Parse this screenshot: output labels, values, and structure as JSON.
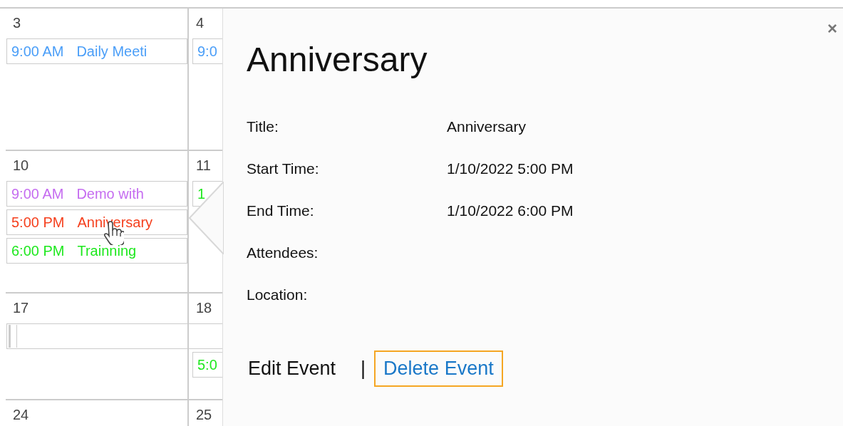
{
  "calendar": {
    "weeks": [
      {
        "days": [
          {
            "number": "3",
            "events": [
              {
                "kind": "event",
                "time": "9:00 AM",
                "title": "Daily Meeti",
                "color": "#4a9ef8"
              }
            ]
          },
          {
            "number": "4",
            "events": [
              {
                "kind": "event",
                "time": "9:0",
                "color": "#4a9ef8"
              }
            ]
          }
        ]
      },
      {
        "days": [
          {
            "number": "10",
            "events": [
              {
                "kind": "event",
                "time": "9:00 AM",
                "title": "Demo with",
                "color": "#c56cf0"
              },
              {
                "kind": "event",
                "time": "5:00 PM",
                "title": "Anniversary",
                "color": "#f5401e"
              },
              {
                "kind": "event",
                "time": "6:00 PM",
                "title": "Trainning",
                "color": "#1ee81e"
              }
            ]
          },
          {
            "number": "11",
            "events": [
              {
                "kind": "event",
                "time": "1",
                "color": "#1ee81e"
              }
            ]
          }
        ]
      },
      {
        "days": [
          {
            "number": "17",
            "events": [
              {
                "kind": "multi-day"
              }
            ]
          },
          {
            "number": "18",
            "events": [
              {
                "kind": "event",
                "time": "5:0",
                "color": "#1ee81e"
              }
            ]
          }
        ]
      },
      {
        "days": [
          {
            "number": "24"
          },
          {
            "number": "25"
          }
        ]
      }
    ]
  },
  "popup": {
    "title": "Anniversary",
    "close": "×",
    "fields": [
      {
        "label": "Title:",
        "value": "Anniversary"
      },
      {
        "label": "Start Time:",
        "value": "1/10/2022 5:00 PM"
      },
      {
        "label": "End Time:",
        "value": "1/10/2022 6:00 PM"
      },
      {
        "label": "Attendees:"
      },
      {
        "label": "Location:"
      }
    ],
    "actions": [
      {
        "label": "Edit Event",
        "focused": false
      },
      {
        "label": "Delete Event",
        "focused": true
      }
    ],
    "separator": "|"
  }
}
